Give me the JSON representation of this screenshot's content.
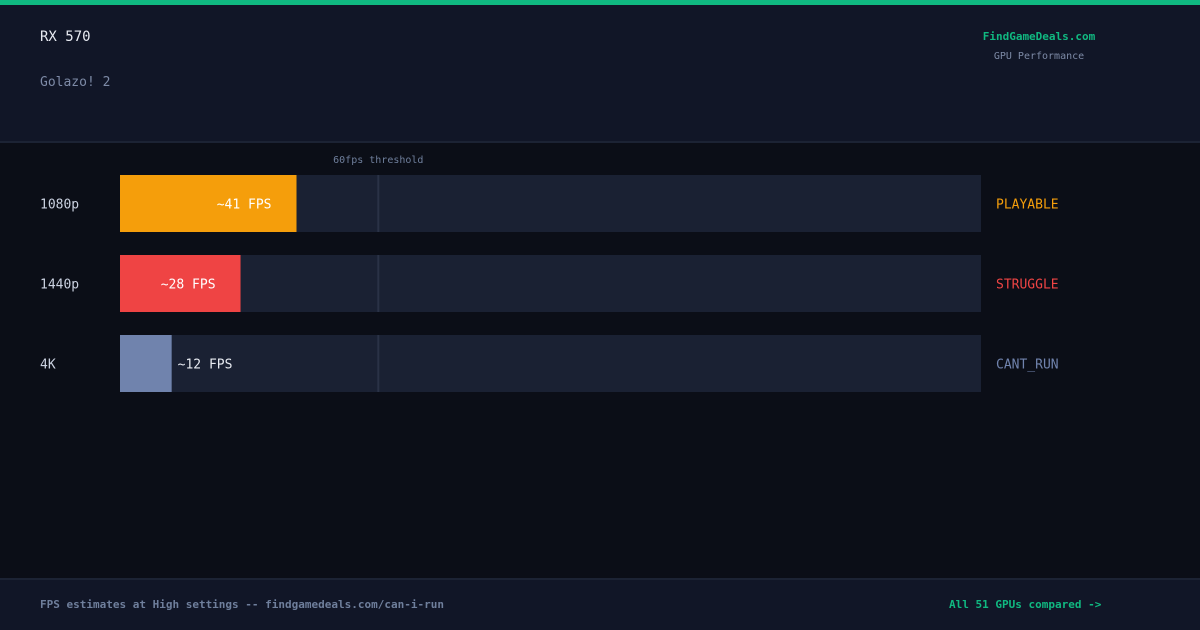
{
  "header": {
    "gpu": "RX 570",
    "game": "Golazo! 2",
    "brand": "FindGameDeals.com",
    "brand_subtitle": "GPU Performance"
  },
  "colors": {
    "accent": "#10b981",
    "playable": "#f59e0b",
    "struggle": "#ef4444",
    "cant_run": "#7083ad",
    "track": "#1a2133"
  },
  "chart_data": {
    "type": "bar",
    "orientation": "horizontal",
    "categories": [
      "1080p",
      "1440p",
      "4K"
    ],
    "values": [
      41,
      28,
      12
    ],
    "value_labels": [
      "~41 FPS",
      "~28 FPS",
      "~12 FPS"
    ],
    "status": [
      "PLAYABLE",
      "STRUGGLE",
      "CANT_RUN"
    ],
    "xlim": [
      0,
      200
    ],
    "threshold": {
      "value": 60,
      "label": "60fps threshold"
    },
    "grid": false
  },
  "footer": {
    "note": "FPS estimates at High settings -- findgamedeals.com/can-i-run",
    "link": "All 51 GPUs compared ->"
  }
}
